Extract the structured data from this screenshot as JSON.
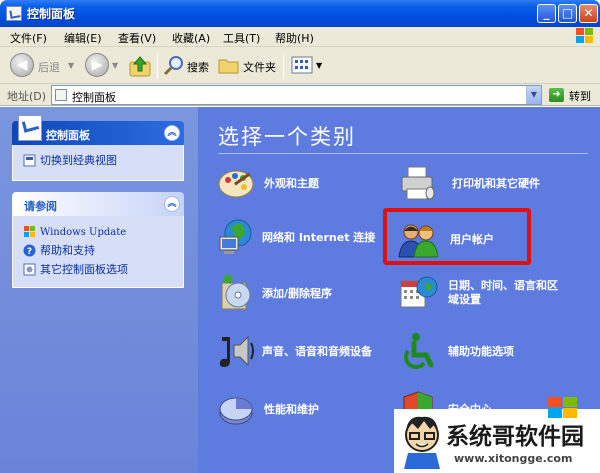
{
  "window": {
    "title": "控制面板"
  },
  "menu": {
    "items": [
      "文件(F)",
      "编辑(E)",
      "查看(V)",
      "收藏(A)",
      "工具(T)",
      "帮助(H)"
    ]
  },
  "toolbar": {
    "back": "后退",
    "search": "搜索",
    "folders": "文件夹"
  },
  "address": {
    "label": "地址(D)",
    "value": "控制面板",
    "go": "转到"
  },
  "sidebar": {
    "panel1": {
      "title": "控制面板",
      "links": [
        "切换到经典视图"
      ]
    },
    "panel2": {
      "title": "请参阅",
      "links": [
        "Windows Update",
        "帮助和支持",
        "其它控制面板选项"
      ]
    }
  },
  "main": {
    "heading": "选择一个类别",
    "categories": [
      {
        "label": "外观和主题",
        "icon": "appearance-icon"
      },
      {
        "label": "打印机和其它硬件",
        "icon": "printer-icon"
      },
      {
        "label": "网络和 Internet 连接",
        "icon": "network-icon"
      },
      {
        "label": "用户帐户",
        "icon": "user-accounts-icon"
      },
      {
        "label": "添加/删除程序",
        "icon": "add-remove-icon"
      },
      {
        "label": "日期、时间、语言和区域设置",
        "label_line1": "日期、时间、语言和区",
        "label_line2": "域设置",
        "icon": "date-time-icon"
      },
      {
        "label": "声音、语音和音频设备",
        "icon": "sound-icon"
      },
      {
        "label": "辅助功能选项",
        "icon": "accessibility-icon"
      },
      {
        "label": "性能和维护",
        "icon": "performance-icon"
      },
      {
        "label": "安全中心",
        "icon": "security-center-icon"
      }
    ]
  },
  "watermark": {
    "title": "系统哥软件园",
    "url": "www.xitongge.com"
  },
  "colors": {
    "titlebar": "#0050e0",
    "content_bg": "#5e7ce0",
    "sidebar_bg": "#7a96df",
    "highlight": "#e01010"
  }
}
